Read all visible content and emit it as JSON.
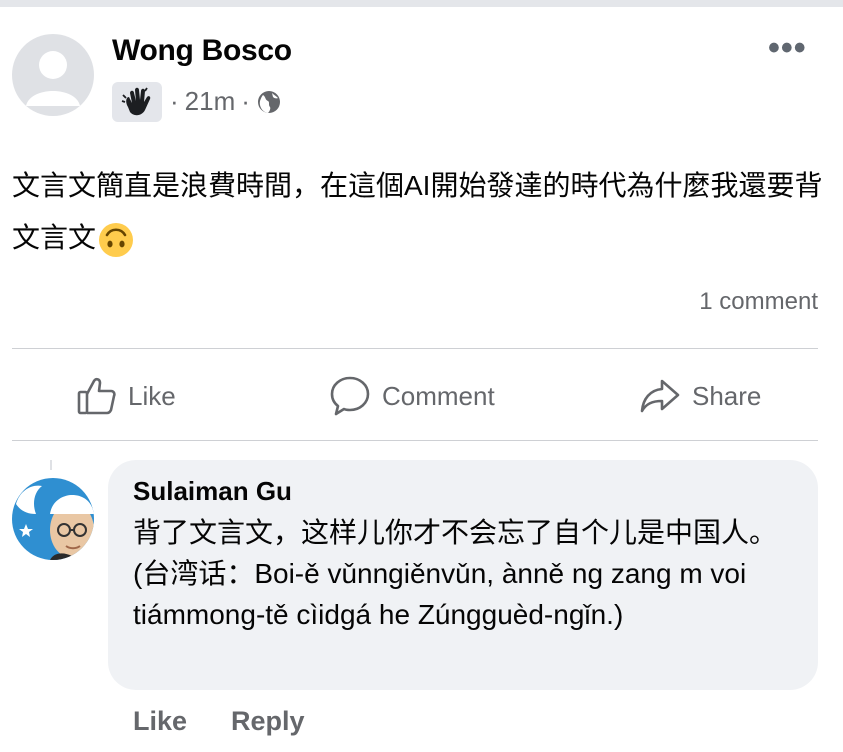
{
  "post": {
    "author": "Wong Bosco",
    "time": "21m",
    "separator": "·",
    "text": "文言文簡直是浪費時間，在這個AI開始發達的時代為什麼我還要背文言文",
    "more": "•••",
    "comment_count": "1 comment",
    "emoji_icon": "upside-down-face-icon",
    "audience_icon": "globe-icon",
    "badge_icon": "waving-hand-icon"
  },
  "actions": {
    "like": "Like",
    "comment": "Comment",
    "share": "Share"
  },
  "comment": {
    "author": "Sulaiman Gu",
    "text": "背了文言文，这样儿你才不会忘了自个儿是中国人。(台湾话：Boi-ě vǔnngiěnvǔn, ànně ng zang m voi tiámmong-tě cìidgá he Zúngguèd-ngǐn.)",
    "like": "Like",
    "reply": "Reply"
  },
  "colors": {
    "text_primary": "#050505",
    "text_secondary": "#65676b",
    "bubble": "#f0f2f5",
    "divider": "#ced0d4"
  }
}
